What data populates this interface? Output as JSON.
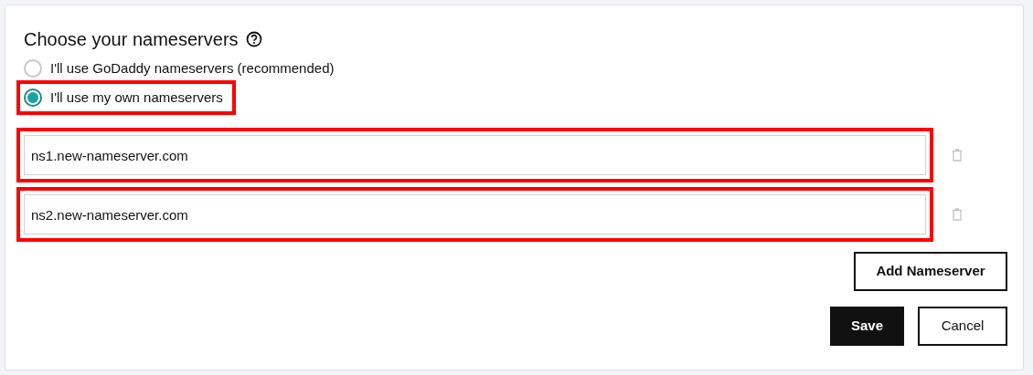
{
  "title": "Choose your nameservers",
  "options": [
    {
      "label": "I'll use GoDaddy nameservers (recommended)",
      "selected": false,
      "highlighted": false
    },
    {
      "label": "I'll use my own nameservers",
      "selected": true,
      "highlighted": true
    }
  ],
  "nameservers": [
    {
      "value": "ns1.new-nameserver.com",
      "highlighted": true
    },
    {
      "value": "ns2.new-nameserver.com",
      "highlighted": true
    }
  ],
  "add_button": "Add Nameserver",
  "buttons": [
    {
      "label": "Save",
      "kind": "primary"
    },
    {
      "label": "Cancel",
      "kind": "secondary"
    }
  ]
}
